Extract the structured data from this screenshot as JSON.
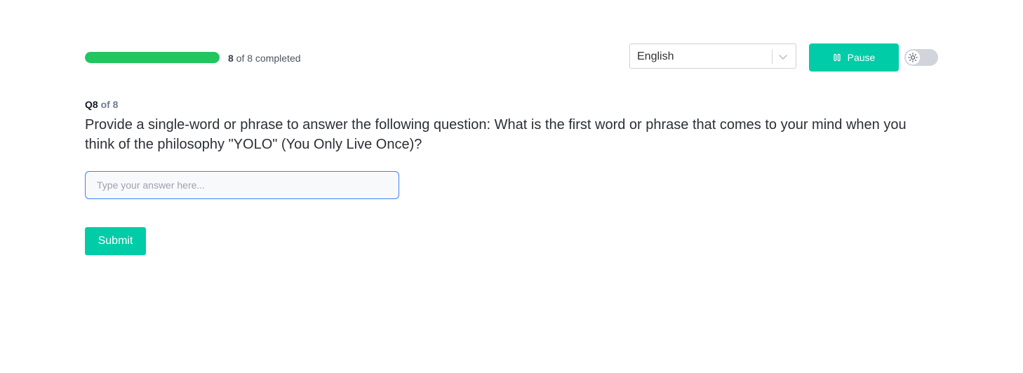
{
  "progress": {
    "completed": "8",
    "suffix": " of 8 completed",
    "fraction": 1.0,
    "fill_color": "#22c55e"
  },
  "language_select": {
    "selected": "English",
    "icon": "chevron-down-icon"
  },
  "pause_button": {
    "label": "Pause",
    "icon": "pause-icon",
    "color": "#00cca7"
  },
  "theme_toggle": {
    "icon": "sun-icon",
    "state": "light"
  },
  "question": {
    "number": "Q8",
    "of_total": " of 8",
    "text": "Provide a single-word or phrase to answer the following question: What is the first word or phrase that comes to your mind when you think of the philosophy \"YOLO\" (You Only Live Once)?"
  },
  "answer": {
    "placeholder": "Type your answer here...",
    "value": ""
  },
  "submit_button": {
    "label": "Submit",
    "color": "#00cca7"
  }
}
